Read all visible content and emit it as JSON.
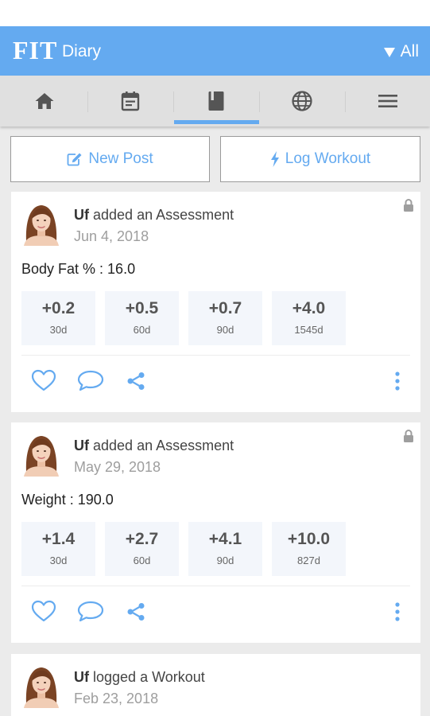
{
  "app": {
    "logo_main": "FIT",
    "logo_sub": "Diary",
    "filter_label": "All",
    "accent": "#64aaf0"
  },
  "tabs": [
    {
      "name": "home-icon",
      "active": false
    },
    {
      "name": "calendar-icon",
      "active": false
    },
    {
      "name": "book-icon",
      "active": true
    },
    {
      "name": "globe-icon",
      "active": false
    },
    {
      "name": "menu-icon",
      "active": false
    }
  ],
  "actions": {
    "new_post": "New Post",
    "log_workout": "Log Workout"
  },
  "feed": [
    {
      "author": "Uf",
      "action": "added an Assessment",
      "date": "Jun 4, 2018",
      "metric": "Body Fat % : 16.0",
      "stats": [
        {
          "value": "+0.2",
          "period": "30d"
        },
        {
          "value": "+0.5",
          "period": "60d"
        },
        {
          "value": "+0.7",
          "period": "90d"
        },
        {
          "value": "+4.0",
          "period": "1545d"
        }
      ]
    },
    {
      "author": "Uf",
      "action": "added an Assessment",
      "date": "May 29, 2018",
      "metric": "Weight : 190.0",
      "stats": [
        {
          "value": "+1.4",
          "period": "30d"
        },
        {
          "value": "+2.7",
          "period": "60d"
        },
        {
          "value": "+4.1",
          "period": "90d"
        },
        {
          "value": "+10.0",
          "period": "827d"
        }
      ]
    },
    {
      "author": "Uf",
      "action": "logged a Workout",
      "date": "Feb 23, 2018"
    }
  ]
}
